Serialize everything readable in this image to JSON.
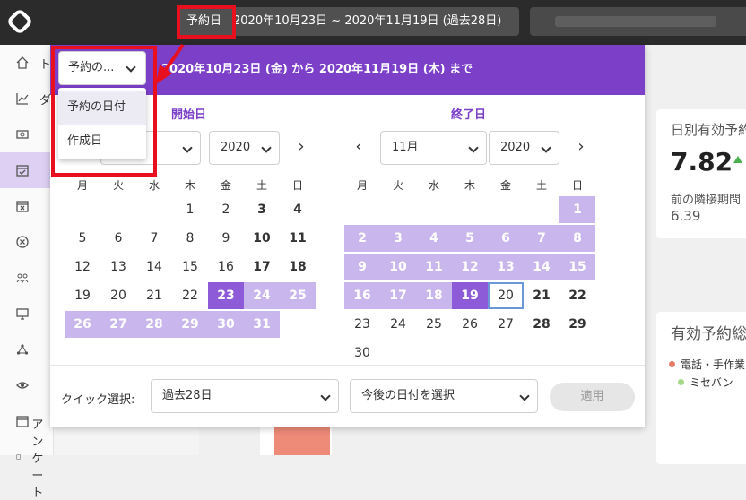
{
  "topbar": {
    "date_label": "予約日",
    "date_range": "2020年10月23日 ~ 2020年11月19日 (過去28日)"
  },
  "sidebar": {
    "items": [
      {
        "icon": "home-icon",
        "label": "ト"
      },
      {
        "icon": "chart-icon",
        "label": "ダ"
      },
      {
        "icon": "money-icon",
        "label": ""
      },
      {
        "icon": "calendar-check-icon",
        "label": ""
      },
      {
        "icon": "calendar-x-icon",
        "label": ""
      },
      {
        "icon": "circle-x-icon",
        "label": ""
      },
      {
        "icon": "users-icon",
        "label": ""
      },
      {
        "icon": "monitor-icon",
        "label": ""
      },
      {
        "icon": "network-icon",
        "label": ""
      },
      {
        "icon": "eye-icon",
        "label": ""
      },
      {
        "icon": "calendar-icon",
        "label": ""
      },
      {
        "icon": "survey-icon",
        "label": "アンケート"
      }
    ]
  },
  "panel": {
    "header_range": "2020年10月23日 (金) から 2020年11月19日 (木) まで",
    "date_type_selected": "予約の...",
    "date_type_options": [
      "予約の日付",
      "作成日"
    ],
    "start_title": "開始日",
    "end_title": "終了日",
    "start_year": "2020",
    "end_month": "11月",
    "end_year": "2020",
    "weekdays": [
      "月",
      "火",
      "水",
      "木",
      "金",
      "土",
      "日"
    ],
    "quick_label": "クイック選択:",
    "quick_value": "過去28日",
    "future_value": "今後の日付を選択",
    "apply_label": "適用"
  },
  "cards": {
    "daily_title": "日別有効予約",
    "daily_value": "7.82",
    "prev_label": "前の隣接期間",
    "prev_value": "6.39",
    "valid_title": "有効予約総",
    "legend1": "電話・手作業",
    "legend2": "ミセバン"
  },
  "colors": {
    "accent": "#7b3fc8",
    "range": "#c9b6ec",
    "selected": "#8e5bd8",
    "annotation": "#e8101e"
  }
}
